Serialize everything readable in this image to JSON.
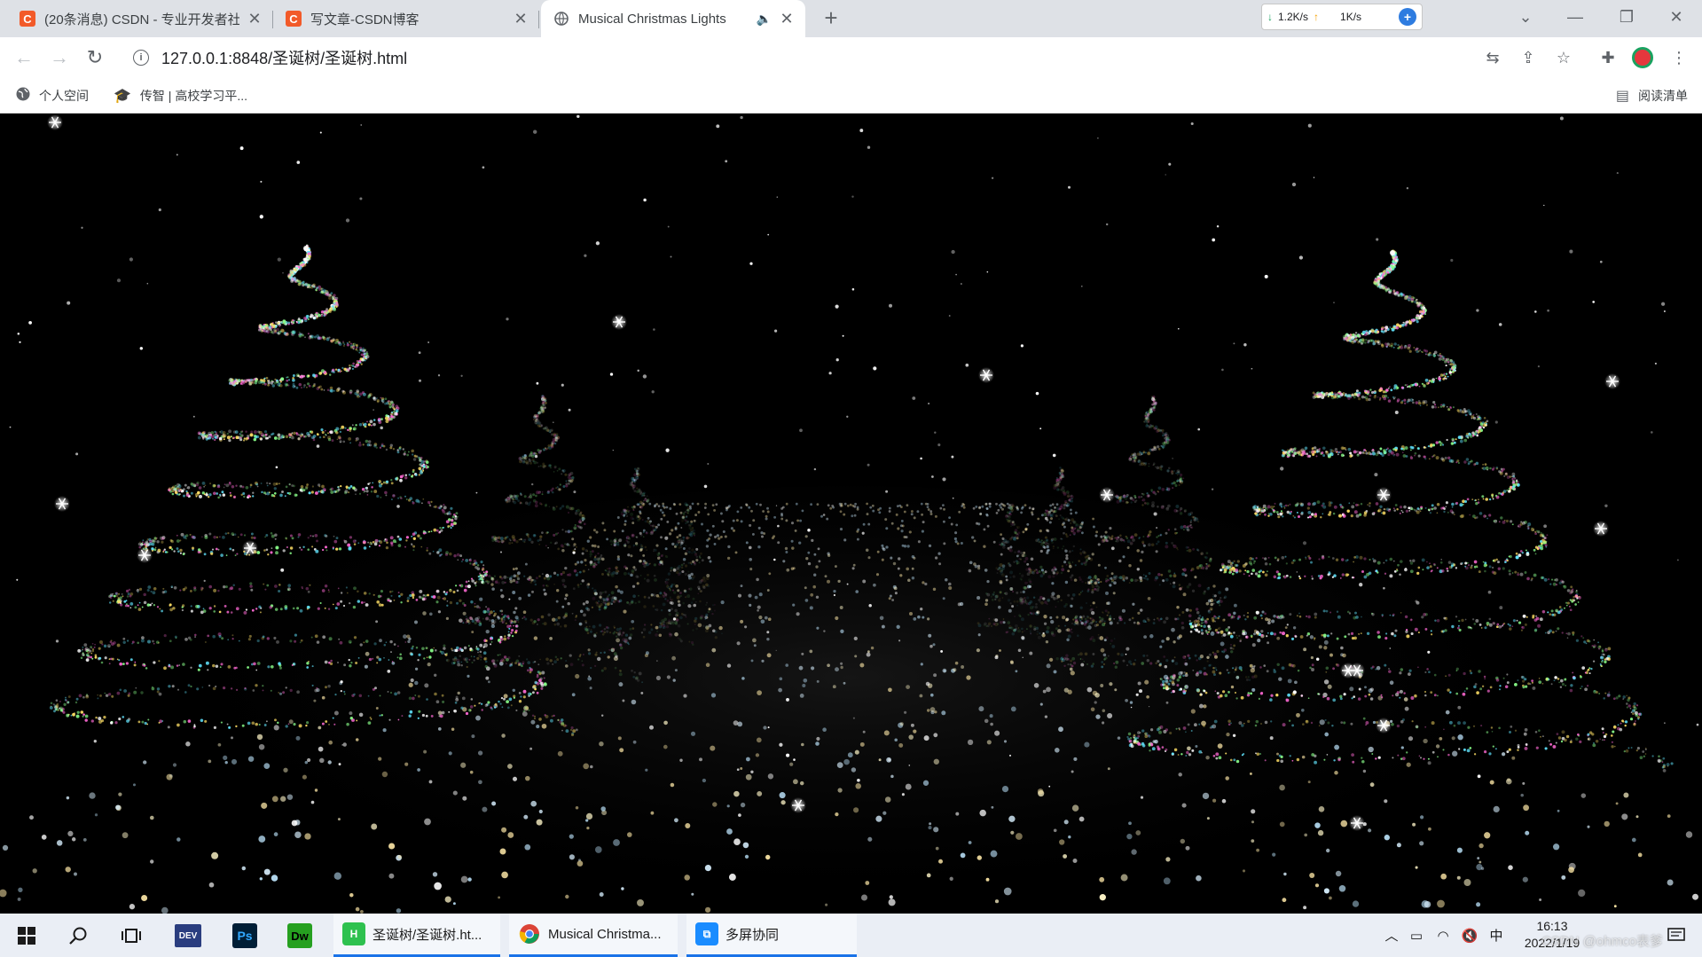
{
  "browser": {
    "tabs": [
      {
        "title": "(20条消息) CSDN - 专业开发者社",
        "favicon": "csdn-icon",
        "active": false
      },
      {
        "title": "写文章-CSDN博客",
        "favicon": "csdn-icon",
        "active": false
      },
      {
        "title": "Musical Christmas Lights",
        "favicon": "globe-icon",
        "active": true,
        "audio": true
      }
    ],
    "net_widget": {
      "download": "1.2K/s",
      "upload": "1K/s"
    },
    "address": {
      "url": "127.0.0.1:8848/圣诞树/圣诞树.html"
    },
    "bookmarks": [
      {
        "label": "个人空间",
        "icon": "globe-icon"
      },
      {
        "label": "传智 | 高校学习平...",
        "icon": "graduation-cap-icon"
      }
    ],
    "reading_list": "阅读清单"
  },
  "scene": {
    "description_colors": {
      "background": "#000000",
      "sparkle": "#ffffff",
      "tree_colors": [
        "#ff6ad5",
        "#62e6ff",
        "#ffe066",
        "#8aff8a",
        "#ffffff"
      ]
    }
  },
  "taskbar": {
    "apps": [
      {
        "label": "圣诞树/圣诞树.ht...",
        "icon": "hbuilder-icon"
      },
      {
        "label": "Musical Christma...",
        "icon": "chrome-icon"
      },
      {
        "label": "多屏协同",
        "icon": "multiscreen-icon"
      }
    ],
    "tray": {
      "ime": "中",
      "time": "16:13",
      "date": "2022/1/19"
    },
    "watermark": "CSDN @ohmco表爹"
  }
}
